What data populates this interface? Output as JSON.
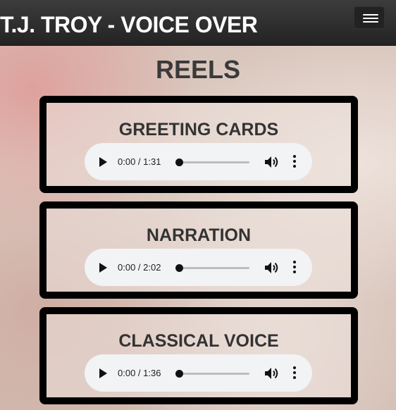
{
  "navbar": {
    "brand": "T.J. TROY - VOICE OVER",
    "toggle_icon": "hamburger-menu-icon"
  },
  "page": {
    "title": "REELS"
  },
  "reels": [
    {
      "title": "GREETING CARDS",
      "time": "0:00 / 1:31"
    },
    {
      "title": "NARRATION",
      "time": "0:00 / 2:02"
    },
    {
      "title": "CLASSICAL VOICE",
      "time": "0:00 / 1:36"
    }
  ],
  "player_icons": {
    "play": "play-icon",
    "volume": "volume-icon",
    "more": "more-options-icon"
  },
  "colors": {
    "navbar": "#2b2b2b",
    "reel_border": "#000000",
    "player_bg": "#f1f3f4"
  }
}
